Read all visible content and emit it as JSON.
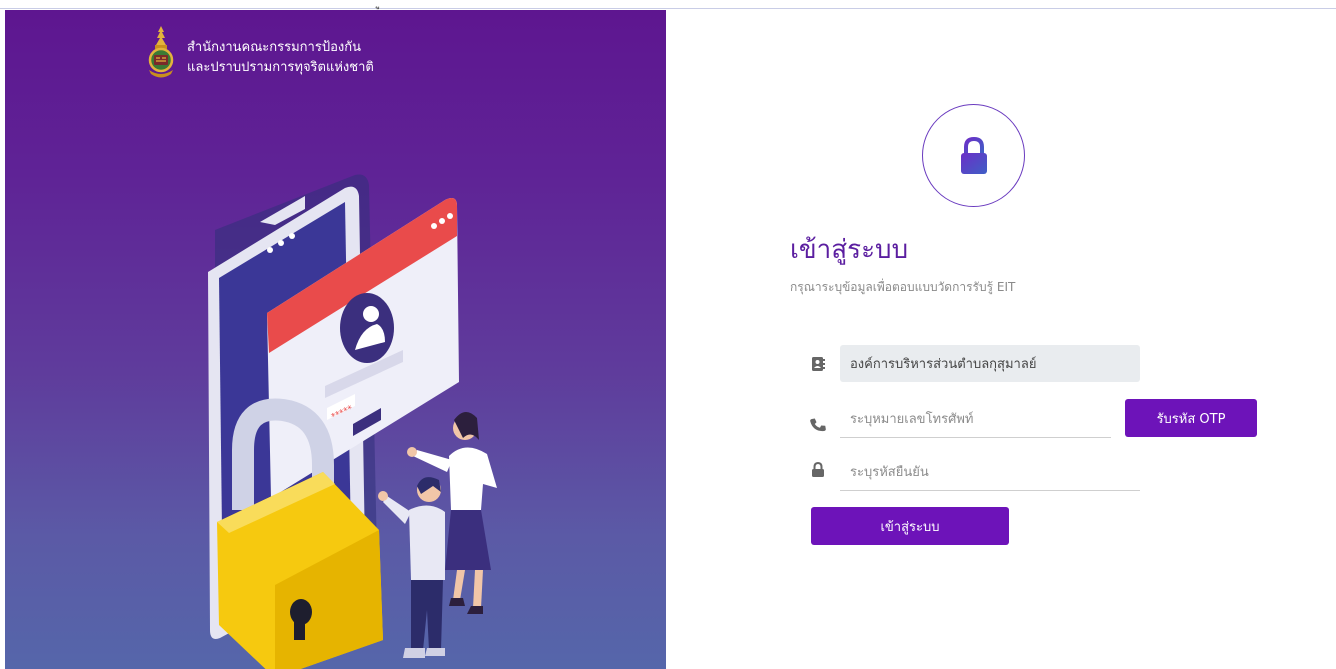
{
  "header": {
    "top_fragment": "ู"
  },
  "brand": {
    "line1": "สำนักงานคณะกรรมการป้องกัน",
    "line2": "และปราบปรามการทุจริตแห่งชาติ",
    "logo_icon": "nacc-emblem-icon"
  },
  "illustration": {
    "password_mask": "*****",
    "icon": "padlock-phone-illustration"
  },
  "login": {
    "lock_icon": "lock-icon",
    "title": "เข้าสู่ระบบ",
    "subtitle": "กรุณาระบุข้อมูลเพื่อตอบแบบวัดการรับรู้ EIT",
    "organization": {
      "icon": "address-book-icon",
      "value": "องค์การบริหารส่วนตำบลกุสุมาลย์"
    },
    "phone": {
      "icon": "phone-icon",
      "placeholder": "ระบุหมายเลขโทรศัพท์",
      "value": ""
    },
    "otp_button": "รับรหัส OTP",
    "code": {
      "icon": "lock-icon",
      "placeholder": "ระบุรหัสยืนยัน",
      "value": ""
    },
    "submit_button": "เข้าสู่ระบบ"
  },
  "colors": {
    "accent": "#6d13b9",
    "title": "#5b1ea0",
    "panel_top": "#5e1690",
    "panel_bottom": "#5566aa"
  }
}
